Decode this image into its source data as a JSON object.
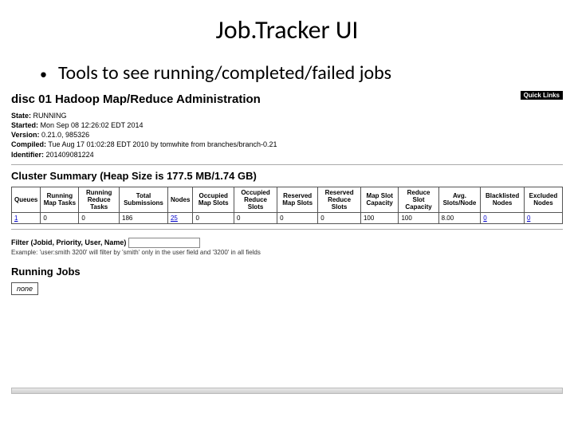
{
  "slide": {
    "title": "Job.Tracker UI",
    "bullet": "Tools to see running/completed/failed jobs"
  },
  "header": {
    "quicklinks": "Quick Links",
    "title": "disc 01 Hadoop Map/Reduce Administration"
  },
  "meta": {
    "state_label": "State:",
    "state_value": "RUNNING",
    "started_label": "Started:",
    "started_value": "Mon Sep 08 12:26:02 EDT 2014",
    "version_label": "Version:",
    "version_value": "0.21.0, 985326",
    "compiled_label": "Compiled:",
    "compiled_value": "Tue Aug 17 01:02:28 EDT 2010 by tomwhite from branches/branch-0.21",
    "identifier_label": "Identifier:",
    "identifier_value": "201409081224"
  },
  "cluster": {
    "heading": "Cluster Summary (Heap Size is 177.5 MB/1.74 GB)",
    "cols": {
      "queues": "Queues",
      "run_map": "Running Map Tasks",
      "run_reduce": "Running Reduce Tasks",
      "total_sub": "Total Submissions",
      "nodes": "Nodes",
      "occ_map": "Occupied Map Slots",
      "occ_reduce": "Occupied Reduce Slots",
      "res_map": "Reserved Map Slots",
      "res_reduce": "Reserved Reduce Slots",
      "map_cap": "Map Slot Capacity",
      "reduce_cap": "Reduce Slot Capacity",
      "avg_slots": "Avg. Slots/Node",
      "blacklisted": "Blacklisted Nodes",
      "excluded": "Excluded Nodes"
    },
    "row": {
      "queues": "1",
      "run_map": "0",
      "run_reduce": "0",
      "total_sub": "186",
      "nodes": "25",
      "occ_map": "0",
      "occ_reduce": "0",
      "res_map": "0",
      "res_reduce": "0",
      "map_cap": "100",
      "reduce_cap": "100",
      "avg_slots": "8.00",
      "blacklisted": "0",
      "excluded": "0"
    }
  },
  "filter": {
    "label": "Filter (Jobid, Priority, User, Name)",
    "placeholder": "",
    "note": "Example: 'user:smith 3200' will filter by 'smith' only in the user field and '3200' in all fields"
  },
  "running": {
    "heading": "Running Jobs",
    "none": "none"
  }
}
